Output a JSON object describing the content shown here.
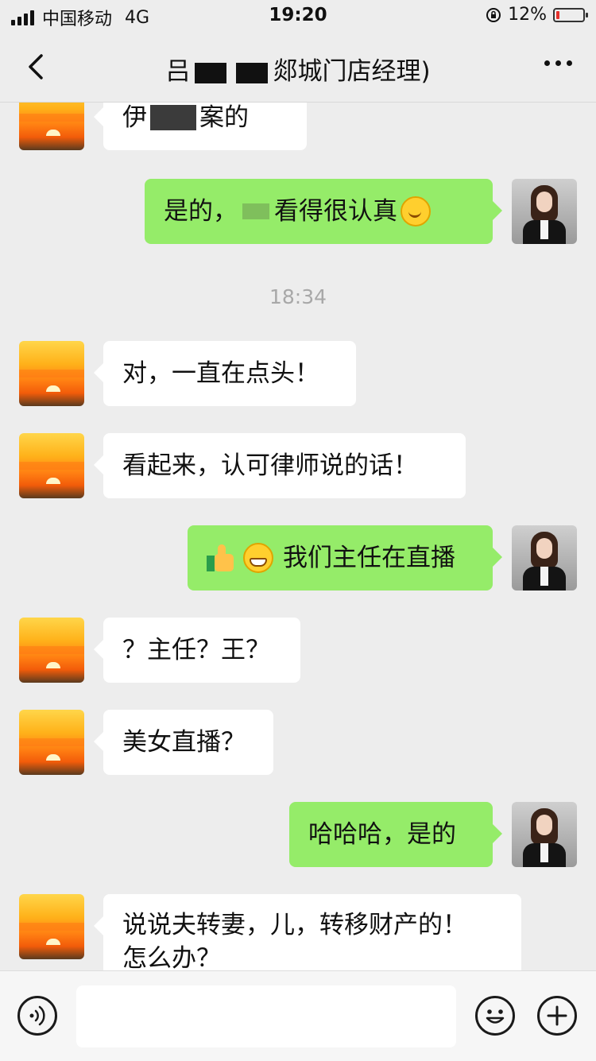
{
  "status_bar": {
    "carrier": "中国移动",
    "network": "4G",
    "time": "19:20",
    "battery_percent": "12%",
    "battery_level": 0.12
  },
  "nav": {
    "title_prefix": "吕",
    "title_suffix": "郯城门店经理)"
  },
  "messages": [
    {
      "side": "left",
      "text_a": "伊",
      "text_b": "案的"
    },
    {
      "side": "right",
      "text_a": "是的，",
      "text_b": "看得很认真",
      "emoji": "smile-emoji"
    },
    {
      "type": "time",
      "text": "18:34"
    },
    {
      "side": "left",
      "text": "对，一直在点头！"
    },
    {
      "side": "left",
      "text": "看起来，认可律师说的话！"
    },
    {
      "side": "right",
      "text": "我们主任在直播",
      "emoji": [
        "thumbs-up-emoji",
        "grin-emoji"
      ]
    },
    {
      "side": "left",
      "text": "？主任？王？"
    },
    {
      "side": "left",
      "text": "美女直播？"
    },
    {
      "side": "right",
      "text": "哈哈哈，是的"
    },
    {
      "side": "left",
      "line1": "说说夫转妻，儿，转移财产的！",
      "line2": "怎么办？"
    }
  ],
  "input": {
    "value": "",
    "placeholder": ""
  },
  "icons": {
    "back": "back-chevron-icon",
    "more": "more-dots-icon",
    "voice": "voice-icon",
    "emoji": "emoji-face-icon",
    "plus": "plus-icon"
  },
  "colors": {
    "background": "#ededed",
    "bubble_self": "#95ec69",
    "bubble_other": "#ffffff",
    "battery_low": "#e5322d"
  }
}
